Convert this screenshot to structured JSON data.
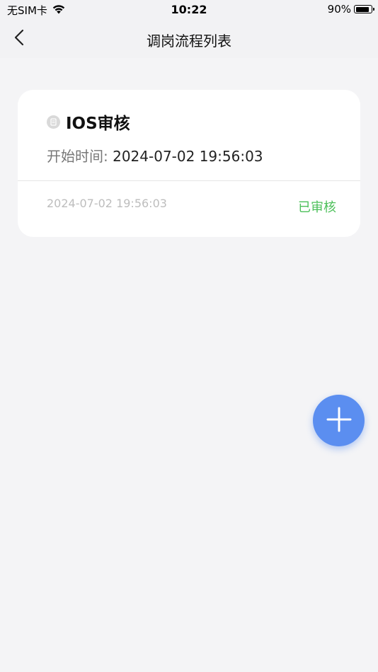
{
  "status_bar": {
    "carrier": "无SIM卡",
    "time": "10:22",
    "battery_percent": "90%",
    "battery_level": 0.9,
    "wifi_icon": "wifi-icon"
  },
  "nav": {
    "title": "调岗流程列表",
    "back_icon": "chevron-left-icon"
  },
  "list": [
    {
      "title": "IOS审核",
      "start_label": "开始时间:",
      "start_time": "2024-07-02 19:56:03",
      "footer_time": "2024-07-02 19:56:03",
      "status": "已审核",
      "status_color": "#4cc05a"
    }
  ],
  "fab": {
    "icon": "plus-icon",
    "color": "#5b8ef0"
  }
}
